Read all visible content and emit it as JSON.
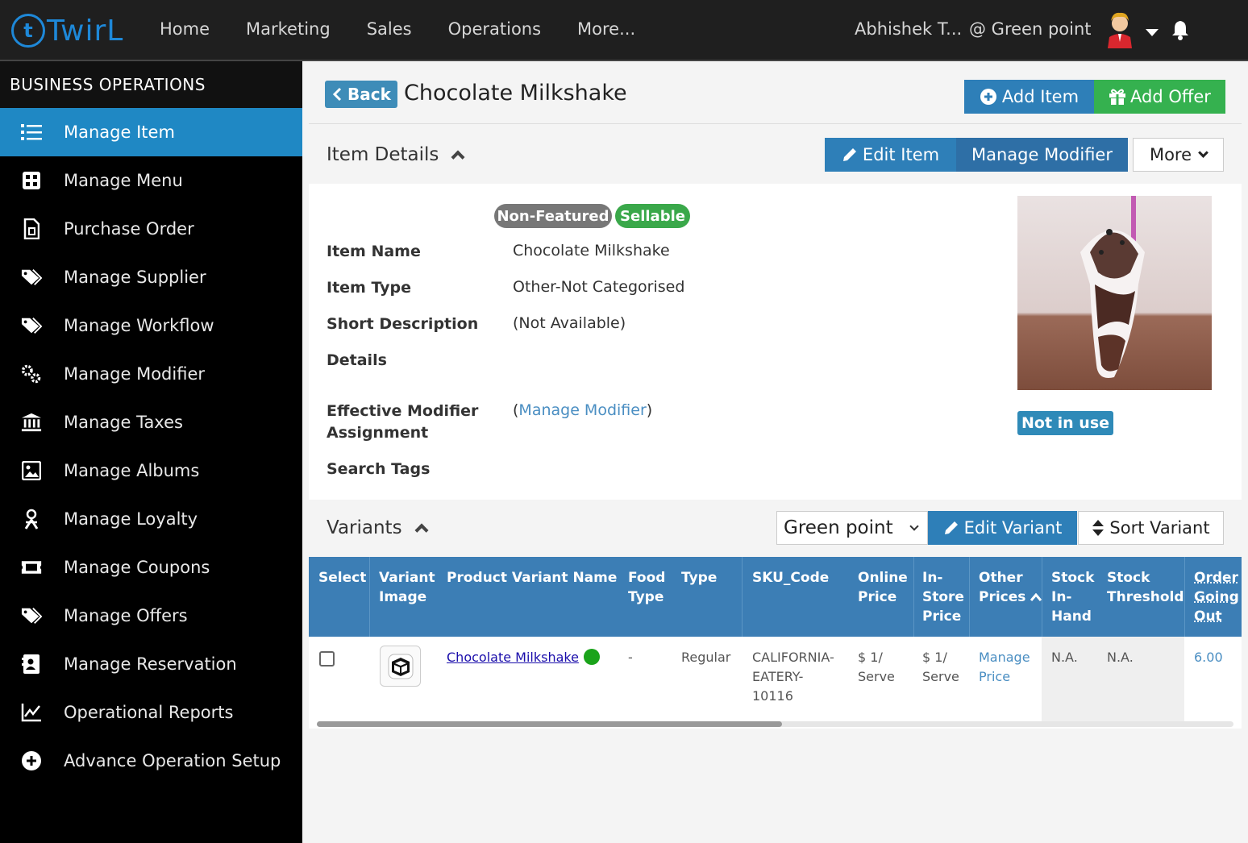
{
  "app": {
    "logo_text": "TwirL",
    "nav": [
      "Home",
      "Marketing",
      "Sales",
      "Operations",
      "More..."
    ],
    "user_name": "Abhishek T...",
    "location": "@ Green point"
  },
  "sidebar": {
    "title": "BUSINESS OPERATIONS",
    "items": [
      {
        "label": "Manage Item",
        "icon": "list-icon",
        "active": true
      },
      {
        "label": "Manage Menu",
        "icon": "grid-icon"
      },
      {
        "label": "Purchase Order",
        "icon": "document-icon"
      },
      {
        "label": "Manage Supplier",
        "icon": "tags-icon"
      },
      {
        "label": "Manage Workflow",
        "icon": "tags-icon"
      },
      {
        "label": "Manage Modifier",
        "icon": "gears-icon"
      },
      {
        "label": "Manage Taxes",
        "icon": "bank-icon"
      },
      {
        "label": "Manage Albums",
        "icon": "image-icon"
      },
      {
        "label": "Manage Loyalty",
        "icon": "person-icon"
      },
      {
        "label": "Manage Coupons",
        "icon": "ticket-icon"
      },
      {
        "label": "Manage Offers",
        "icon": "tags-icon"
      },
      {
        "label": "Manage Reservation",
        "icon": "contact-card-icon"
      },
      {
        "label": "Operational Reports",
        "icon": "line-chart-icon"
      },
      {
        "label": "Advance Operation Setup",
        "icon": "plus-circle-icon"
      }
    ]
  },
  "header": {
    "back_label": "Back",
    "title": "Chocolate Milkshake",
    "add_item_label": "Add Item",
    "add_offer_label": "Add Offer"
  },
  "item_details": {
    "section_title": "Item Details",
    "edit_item_label": "Edit Item",
    "manage_modifier_label": "Manage Modifier",
    "more_label": "More",
    "badges": [
      "Non-Featured",
      "Sellable"
    ],
    "fields": {
      "item_name_label": "Item Name",
      "item_name": "Chocolate Milkshake",
      "item_type_label": "Item Type",
      "item_type": "Other-Not Categorised",
      "short_desc_label": "Short Description",
      "short_desc": "(Not Available)",
      "details_label": "Details",
      "effective_mod_label_1": "Effective Modifier",
      "effective_mod_label_2": "Assignment",
      "manage_modifier_link": "Manage Modifier",
      "search_tags_label": "Search Tags"
    },
    "status_label": "Not in use",
    "colors": {
      "featured_badge": "#777777",
      "sellable_badge": "#3aa84a",
      "primary": "#2e7fb8",
      "offer": "#35b14f"
    }
  },
  "variants": {
    "section_title": "Variants",
    "store_selected": "Green point",
    "edit_variant_label": "Edit Variant",
    "sort_variant_label": "Sort Variant",
    "columns": [
      [
        "Select"
      ],
      [
        "Variant",
        "Image"
      ],
      [
        "Product Variant Name"
      ],
      [
        "Food",
        "Type"
      ],
      [
        "Type"
      ],
      [
        "SKU_Code"
      ],
      [
        "Online",
        "Price"
      ],
      [
        "In-",
        "Store",
        "Price"
      ],
      [
        "Other",
        "Prices"
      ],
      [
        "Stock",
        "In-",
        "Hand"
      ],
      [
        "Stock",
        "Threshold"
      ],
      [
        "Order",
        "Going",
        "Out"
      ]
    ],
    "rows": [
      {
        "name": "Chocolate Milkshake",
        "food_type": "-",
        "type": "Regular",
        "sku": [
          "CALIFORNIA-",
          "EATERY-",
          "10116"
        ],
        "online_price": [
          "$ 1/",
          "Serve"
        ],
        "instore_price": [
          "$ 1/",
          "Serve"
        ],
        "other_prices": [
          "Manage",
          "Price"
        ],
        "stock_in_hand": "N.A.",
        "stock_threshold": "N.A.",
        "order_going_out": "6.00"
      }
    ]
  }
}
